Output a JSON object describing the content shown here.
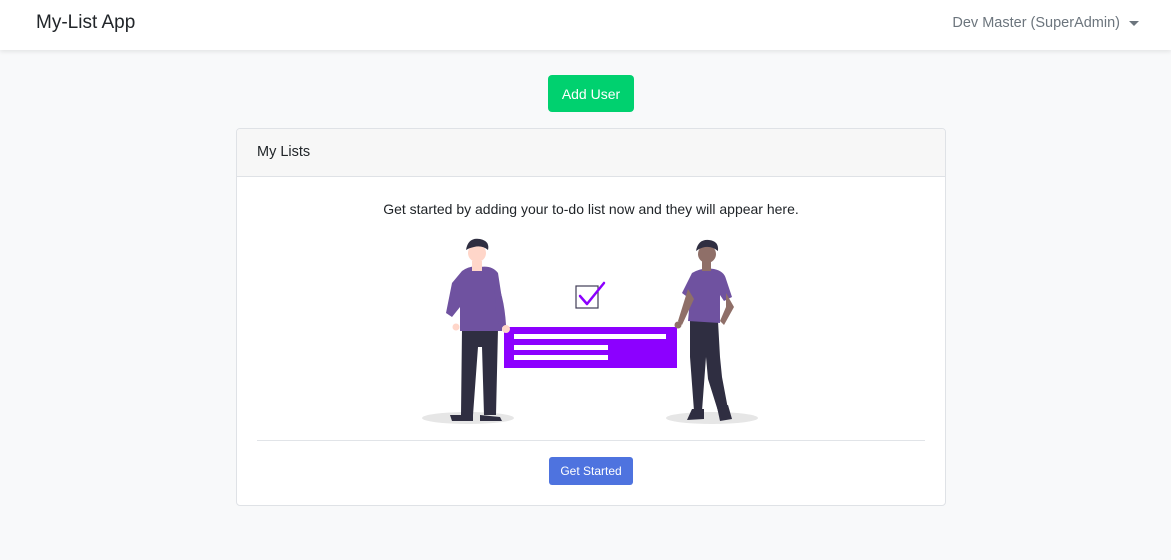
{
  "navbar": {
    "brand": "My-List App",
    "user_menu_label": "Dev Master (SuperAdmin)"
  },
  "actions": {
    "add_user_label": "Add User"
  },
  "card": {
    "header_title": "My Lists",
    "empty_message": "Get started by adding your to-do list now and they will appear here.",
    "get_started_label": "Get Started"
  },
  "colors": {
    "add_user_button": "#00d16f",
    "get_started_button": "#4e73df",
    "illustration_accent": "#8c00ff",
    "illustration_shirt": "#6f52a0",
    "illustration_pants": "#2f2e41"
  },
  "icons": [
    "chevron-down-icon",
    "checkbox-checked-icon"
  ]
}
